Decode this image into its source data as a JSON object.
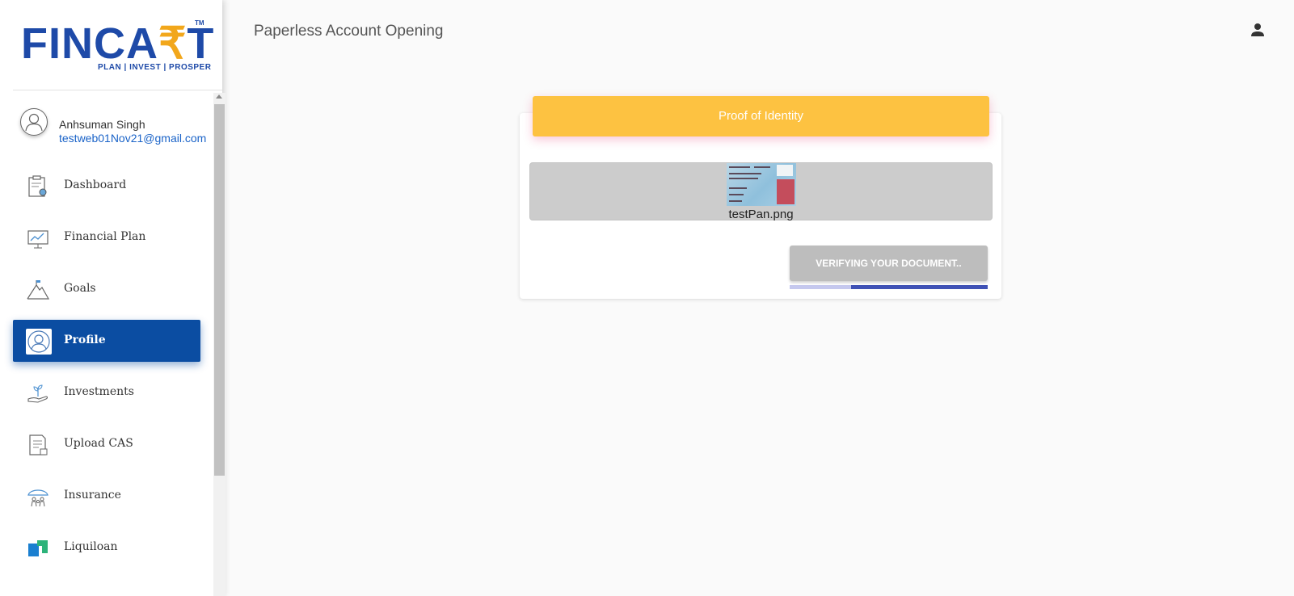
{
  "brand": {
    "logo_text_pre": "FINCA",
    "logo_text_rupee": "₹",
    "logo_text_post": "T",
    "logo_tm": "TM",
    "logo_tagline": "PLAN | INVEST | PROSPER",
    "primary_color": "#1e4aa8",
    "accent_color": "#f2a71b"
  },
  "user": {
    "name": "Anhsuman Singh",
    "email": "testweb01Nov21@gmail.com"
  },
  "sidebar": {
    "items": [
      {
        "label": "Dashboard",
        "icon": "dashboard-clipboard-icon",
        "active": false
      },
      {
        "label": "Financial Plan",
        "icon": "chart-board-icon",
        "active": false
      },
      {
        "label": "Goals",
        "icon": "mountain-flag-icon",
        "active": false
      },
      {
        "label": "Profile",
        "icon": "profile-avatar-icon",
        "active": true
      },
      {
        "label": "Investments",
        "icon": "plant-hand-icon",
        "active": false
      },
      {
        "label": "Upload CAS",
        "icon": "document-upload-icon",
        "active": false
      },
      {
        "label": "Insurance",
        "icon": "umbrella-family-icon",
        "active": false
      },
      {
        "label": "Liquiloan",
        "icon": "liquiloan-logo-icon",
        "active": false
      }
    ],
    "active_color": "#0b4da2"
  },
  "header": {
    "title": "Paperless Account Opening",
    "user_icon": "account-icon"
  },
  "card": {
    "title": "Proof of Identity",
    "header_color": "#fdc241",
    "document": {
      "file_name": "testPan.png",
      "thumbnail": "pan-card-thumbnail"
    },
    "verify_button_label": "VERIFYING YOUR DOCUMENT..",
    "progress": 0.69,
    "progress_color": "#3f51b5"
  }
}
